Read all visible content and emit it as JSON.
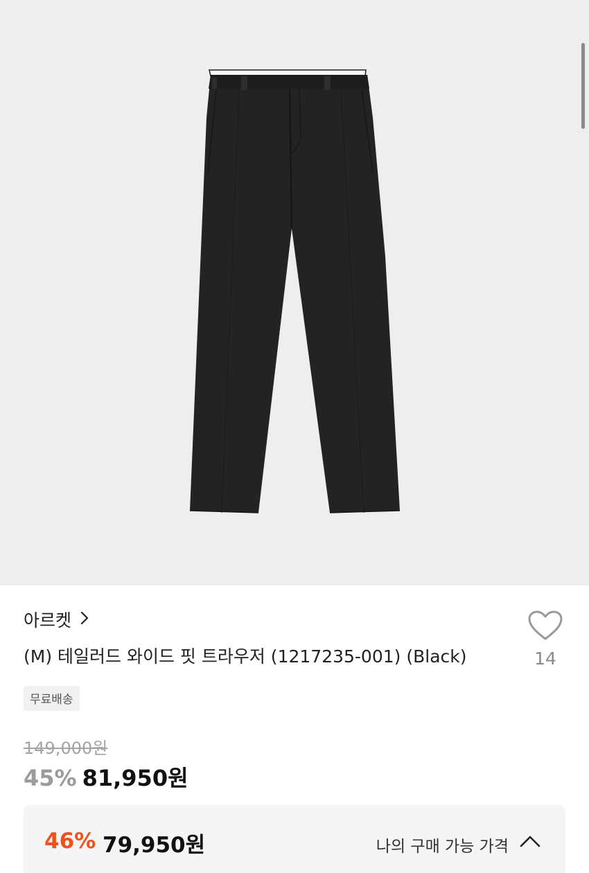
{
  "product": {
    "brand": "아르켓",
    "title": "(M) 테일러드 와이드 핏 트라우저 (1217235-001) (Black)",
    "likes": "14",
    "shipping_badge": "무료배송",
    "original_price": "149,000원",
    "discount_percent": "45%",
    "sale_price": "81,950원"
  },
  "my_price": {
    "discount_percent": "46%",
    "price": "79,950원",
    "label": "나의 구매 가능 가격"
  },
  "icons": {
    "brand_link": "chevron-right-icon",
    "like": "heart-icon",
    "expand": "chevron-up-icon"
  },
  "colors": {
    "image_background": "#eeeeef",
    "accent": "#f2511b",
    "muted": "#9b9b9b"
  }
}
